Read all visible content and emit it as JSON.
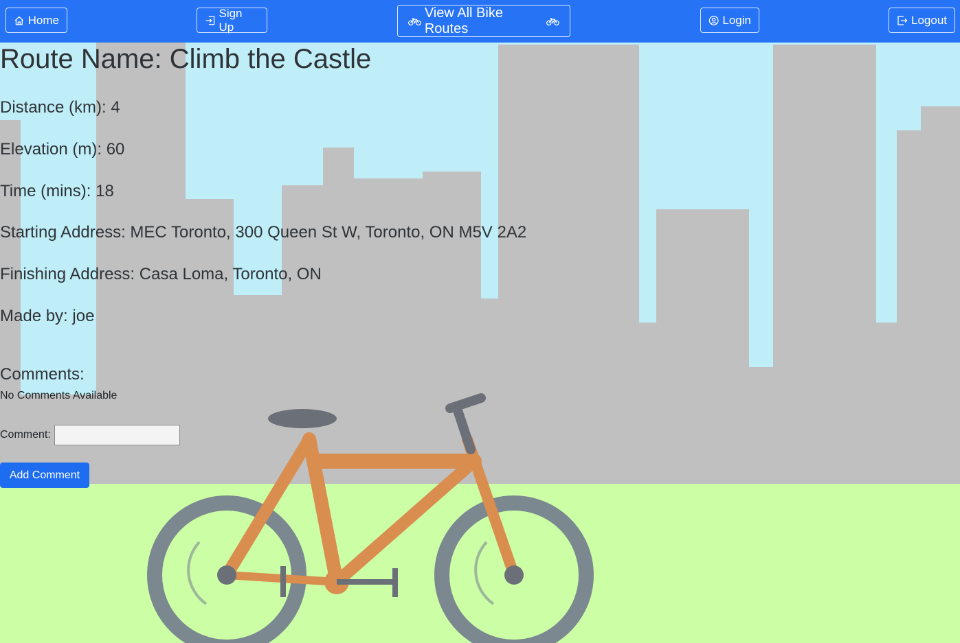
{
  "nav": {
    "home": "Home",
    "signup": "Sign Up",
    "routes": "View All Bike Routes",
    "login": "Login",
    "logout": "Logout"
  },
  "route": {
    "title": "Route Name: Climb the Castle",
    "distance": "Distance (km): 4",
    "elevation": "Elevation (m): 60",
    "time": "Time (mins): 18",
    "start": "Starting Address: MEC Toronto, 300 Queen St W, Toronto, ON M5V 2A2",
    "finish": "Finishing Address: Casa Loma, Toronto, ON",
    "author": "Made by: joe"
  },
  "comments": {
    "heading": "Comments:",
    "empty": "No Comments Available",
    "label": "Comment:",
    "value": "",
    "submit": "Add Comment"
  },
  "colors": {
    "navbar": "#2673f5",
    "button": "#1e6cf0",
    "sky": "#bfeef8",
    "buildings": "#c0c0c0",
    "grass": "#ccfea6",
    "bike_frame": "#d98d4f",
    "bike_wheels": "#7c8890"
  }
}
